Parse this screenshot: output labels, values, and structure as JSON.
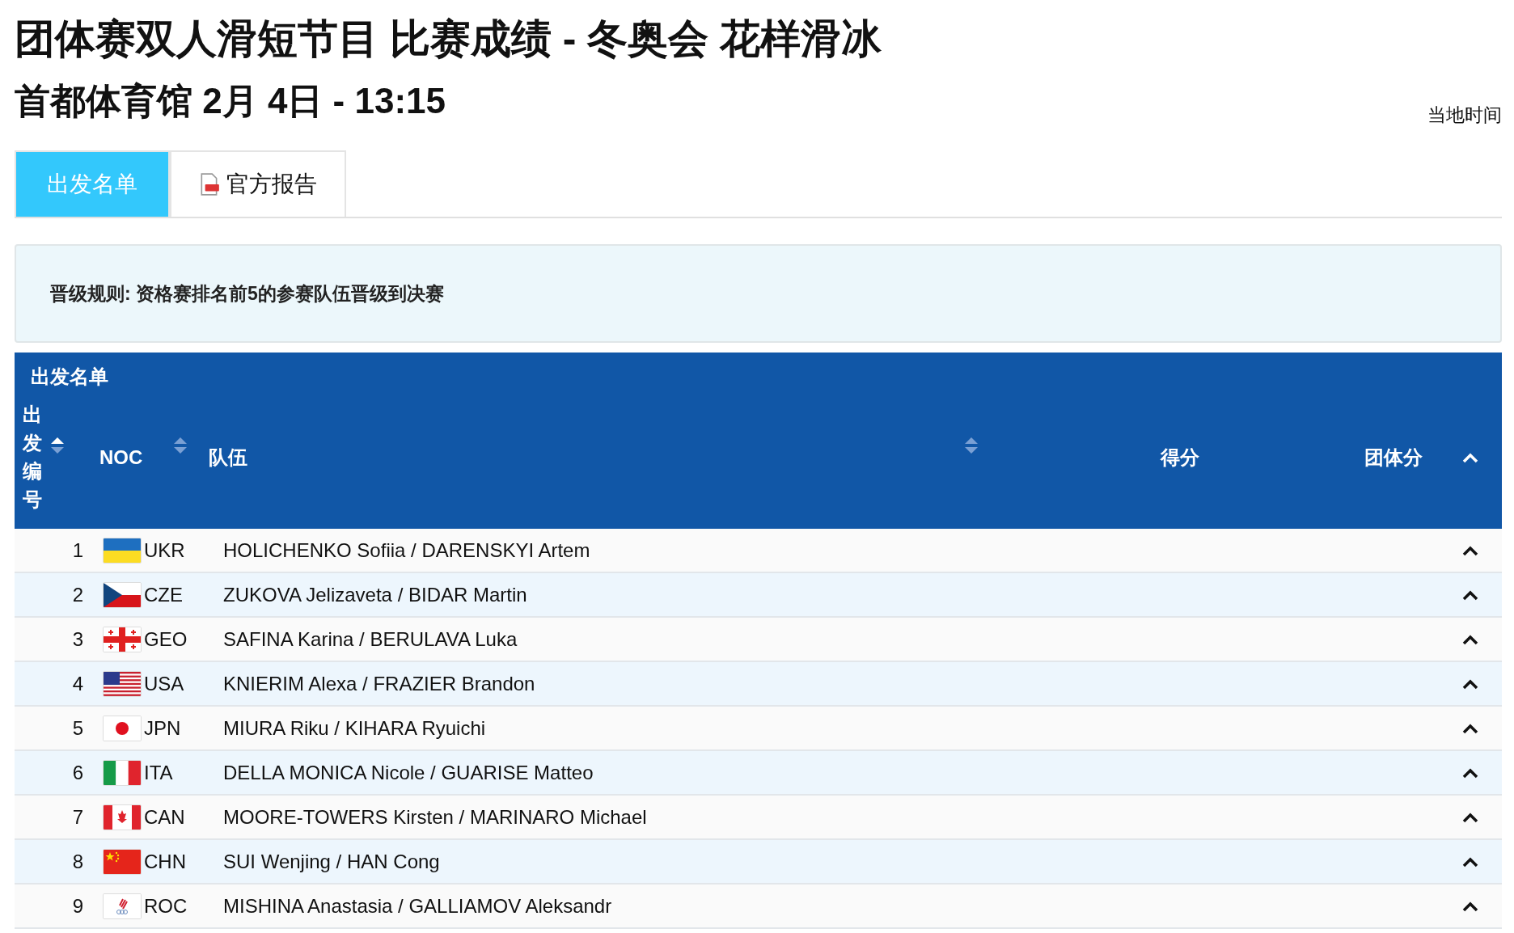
{
  "title": "团体赛双人滑短节目 比赛成绩 - 冬奥会 花样滑冰",
  "subtitle": "首都体育馆 2月 4日 - 13:15",
  "time_note": "当地时间",
  "tabs": [
    {
      "label": "出发名单",
      "selected": true,
      "kind": "plain"
    },
    {
      "label": "官方报告",
      "selected": false,
      "kind": "pdf"
    }
  ],
  "notice": "晋级规则: 资格赛排名前5的参赛队伍晋级到决赛",
  "table": {
    "title": "出发名单",
    "columns": [
      {
        "label": "出发编号",
        "kind": "vertical",
        "sortable": true,
        "sorted": true
      },
      {
        "label": "NOC",
        "kind": "text",
        "sortable": true,
        "sorted": false
      },
      {
        "label": "队伍",
        "kind": "text",
        "sortable": true,
        "sorted": false
      },
      {
        "label": "得分",
        "kind": "text"
      },
      {
        "label": "团体分",
        "kind": "text"
      }
    ],
    "rows": [
      {
        "order": "1",
        "noc": "UKR",
        "team": "HOLICHENKO Sofiia / DARENSKYI Artem"
      },
      {
        "order": "2",
        "noc": "CZE",
        "team": "ZUKOVA Jelizaveta / BIDAR Martin"
      },
      {
        "order": "3",
        "noc": "GEO",
        "team": "SAFINA Karina / BERULAVA Luka"
      },
      {
        "order": "4",
        "noc": "USA",
        "team": "KNIERIM Alexa / FRAZIER Brandon"
      },
      {
        "order": "5",
        "noc": "JPN",
        "team": "MIURA Riku / KIHARA Ryuichi"
      },
      {
        "order": "6",
        "noc": "ITA",
        "team": "DELLA MONICA Nicole / GUARISE Matteo"
      },
      {
        "order": "7",
        "noc": "CAN",
        "team": "MOORE-TOWERS Kirsten / MARINARO Michael"
      },
      {
        "order": "8",
        "noc": "CHN",
        "team": "SUI Wenjing / HAN Cong"
      },
      {
        "order": "9",
        "noc": "ROC",
        "team": "MISHINA Anastasia / GALLIAMOV Aleksandr"
      }
    ]
  }
}
